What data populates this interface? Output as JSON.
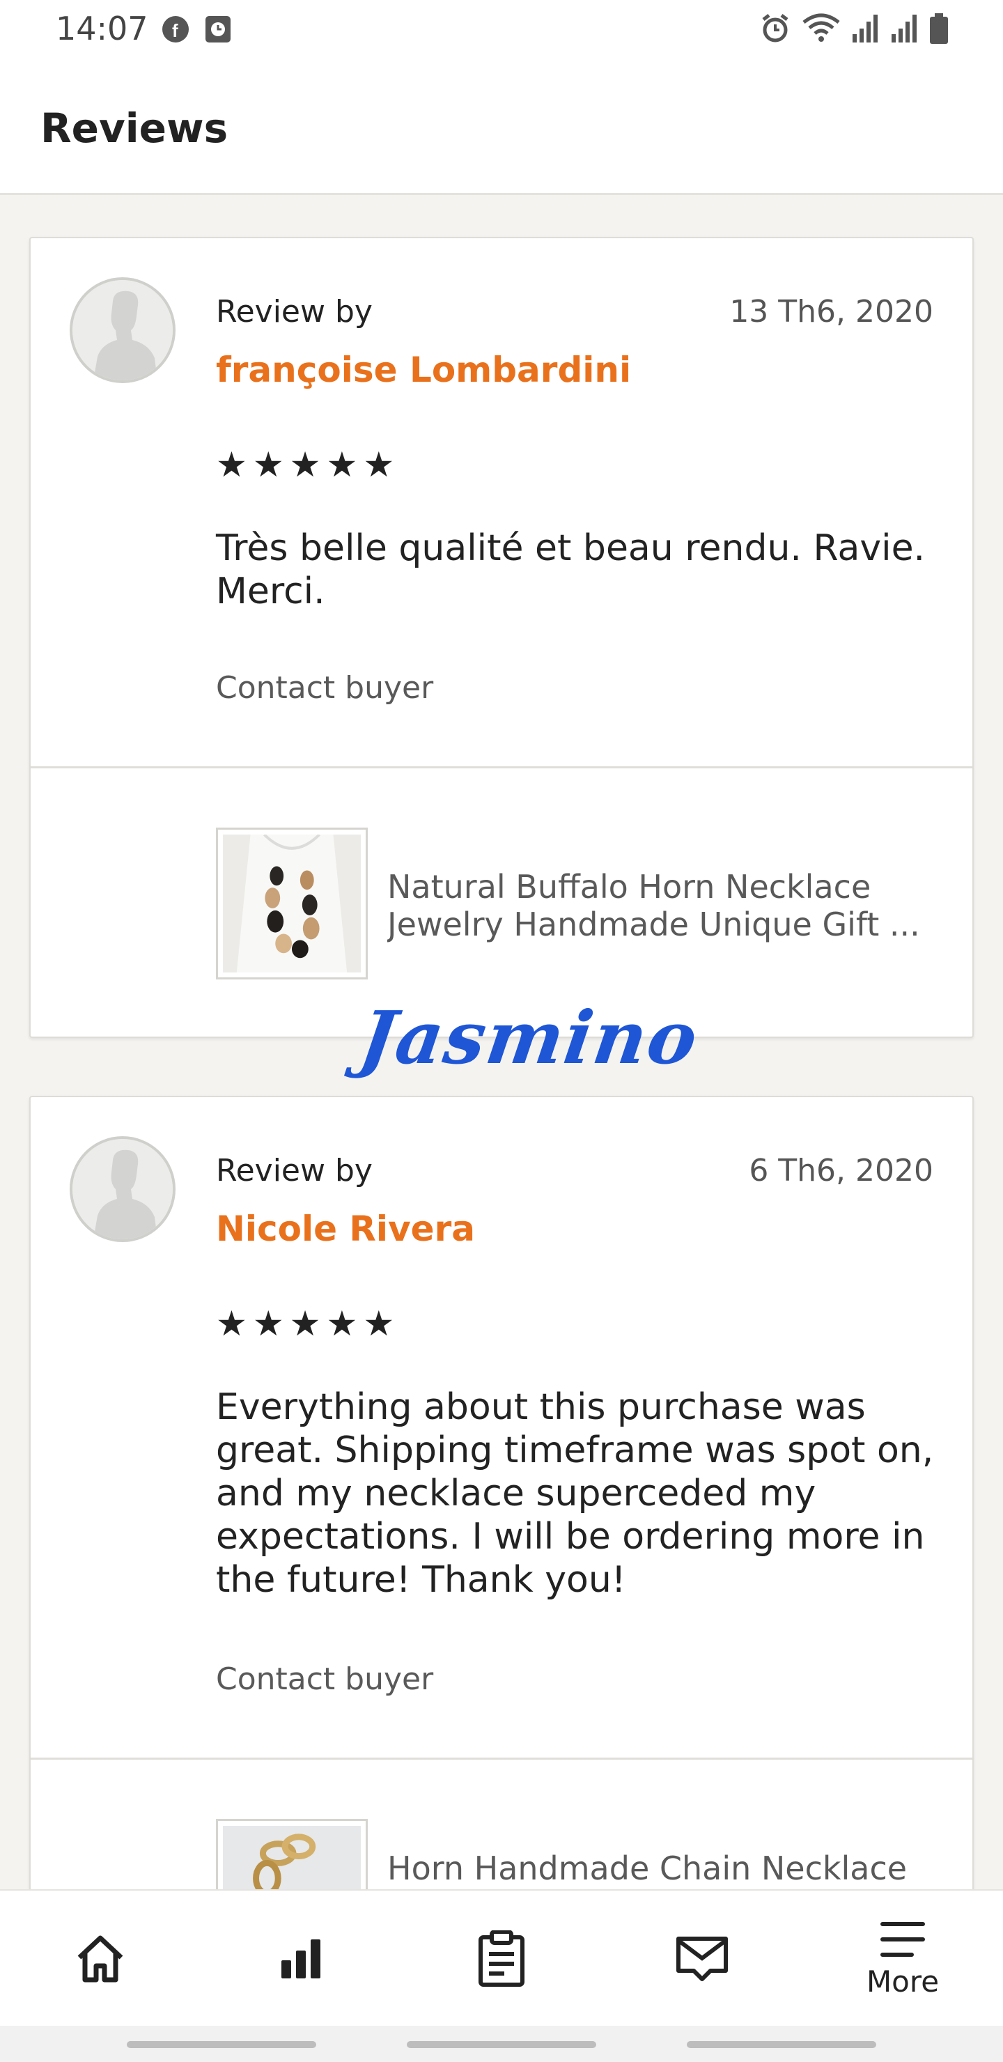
{
  "status_bar": {
    "time": "14:07",
    "left_icons": [
      "facebook-icon",
      "clock-app-icon"
    ],
    "right_icons": [
      "alarm-icon",
      "wifi-icon",
      "signal-icon",
      "signal-icon",
      "battery-icon"
    ]
  },
  "header": {
    "title": "Reviews"
  },
  "reviews": [
    {
      "review_by_label": "Review by",
      "date": "13 Th6, 2020",
      "reviewer": "françoise Lombardini",
      "rating": 5,
      "text": "Très belle qualité et beau rendu. Ravie. Merci.",
      "contact_label": "Contact buyer",
      "listing_title_line1": "Natural Buffalo Horn Necklace",
      "listing_title_line2": "Jewelry Handmade Unique Gift ..."
    },
    {
      "review_by_label": "Review by",
      "date": "6 Th6, 2020",
      "reviewer": "Nicole Rivera",
      "rating": 5,
      "text": "Everything about this purchase was great. Shipping timeframe was spot on, and my necklace superceded my expectations. I will be ordering more in the future! Thank you!",
      "contact_label": "Contact buyer",
      "listing_title_line1": "Horn Handmade Chain Necklace",
      "listing_title_line2": ""
    }
  ],
  "watermark": "Jasmino",
  "bottom_nav": {
    "items": [
      {
        "icon": "home-icon",
        "label": ""
      },
      {
        "icon": "stats-icon",
        "label": ""
      },
      {
        "icon": "orders-clipboard-icon",
        "label": ""
      },
      {
        "icon": "messages-icon",
        "label": ""
      },
      {
        "icon": "menu-icon",
        "label": "More"
      }
    ]
  },
  "colors": {
    "accent": "#e9711c",
    "watermark": "#1e56d6",
    "background": "#f4f3f0"
  }
}
